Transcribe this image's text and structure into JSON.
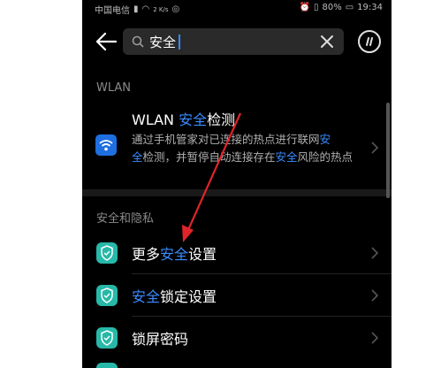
{
  "status_bar": {
    "carrier": "中国电信",
    "net_speed": "2 K/s",
    "battery": "80%",
    "time": "19:34"
  },
  "search": {
    "query": "安全"
  },
  "sections": {
    "wlan": "WLAN",
    "security": "安全和隐私"
  },
  "wlan_item": {
    "title_prefix": "WLAN ",
    "title_hl": "安全",
    "title_suffix": "检测",
    "desc_1": "通过手机管家对已连接的热点进行联网",
    "desc_hl_1": "安",
    "desc_hl_2": "全",
    "desc_2": "检测，并暂停自动连接存在",
    "desc_hl_3": "安全",
    "desc_3": "风险的热点"
  },
  "items": [
    {
      "pre": "更多",
      "hl": "安全",
      "post": "设置"
    },
    {
      "pre": "",
      "hl": "安全",
      "post": "锁定设置"
    },
    {
      "pre": "锁屏密码",
      "hl": "",
      "post": ""
    }
  ],
  "colors": {
    "highlight": "#3a8cff",
    "shield": "#27b8a8",
    "wifi": "#1f6fe0",
    "annotation_arrow": "#e0242a"
  }
}
